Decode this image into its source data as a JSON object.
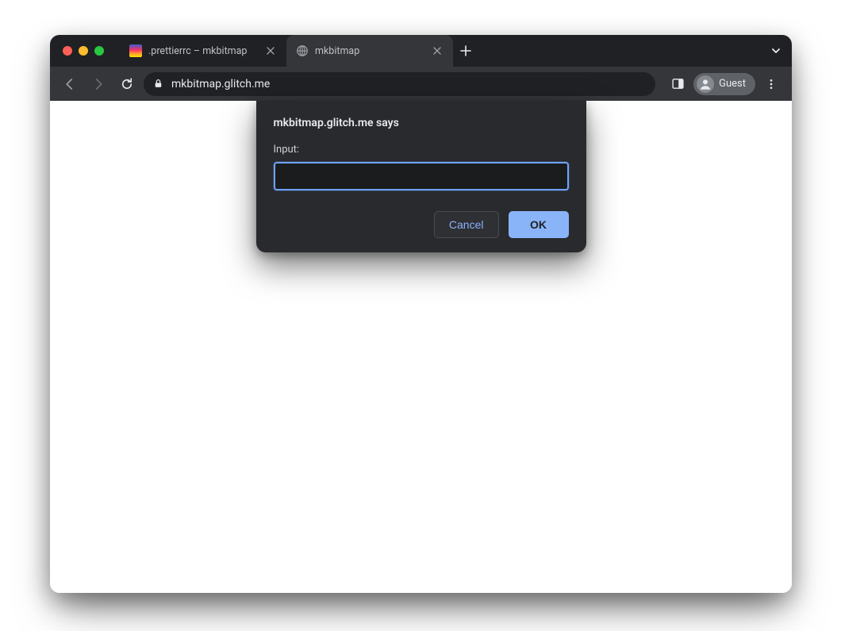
{
  "tabs": [
    {
      "label": ".prettierrc – mkbitmap",
      "active": false,
      "favicon": "glitch"
    },
    {
      "label": "mkbitmap",
      "active": true,
      "favicon": "globe"
    }
  ],
  "address_bar": {
    "url_display": "mkbitmap.glitch.me"
  },
  "profile": {
    "label": "Guest"
  },
  "dialog": {
    "origin_says": "mkbitmap.glitch.me says",
    "label": "Input:",
    "value": "",
    "cancel": "Cancel",
    "ok": "OK"
  }
}
